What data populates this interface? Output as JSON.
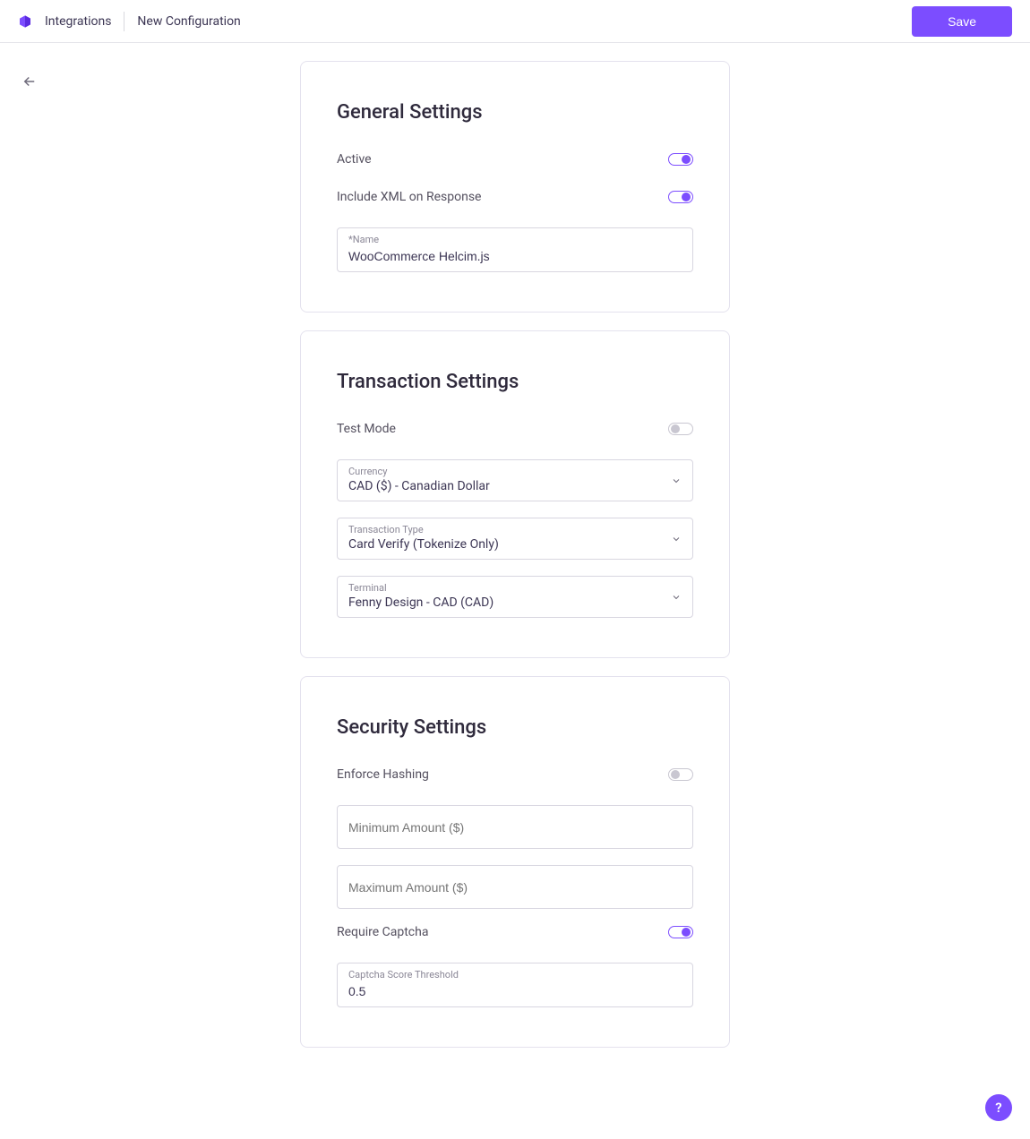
{
  "header": {
    "breadcrumb": [
      "Integrations",
      "New Configuration"
    ],
    "save_label": "Save"
  },
  "general": {
    "title": "General Settings",
    "active_label": "Active",
    "active_on": true,
    "include_xml_label": "Include XML on Response",
    "include_xml_on": true,
    "name_label": "*Name",
    "name_value": "WooCommerce Helcim.js"
  },
  "transaction": {
    "title": "Transaction Settings",
    "test_mode_label": "Test Mode",
    "test_mode_on": false,
    "currency_label": "Currency",
    "currency_value": "CAD ($) - Canadian Dollar",
    "txn_type_label": "Transaction Type",
    "txn_type_value": "Card Verify (Tokenize Only)",
    "terminal_label": "Terminal",
    "terminal_value": "Fenny Design - CAD (CAD)"
  },
  "security": {
    "title": "Security Settings",
    "enforce_hashing_label": "Enforce Hashing",
    "enforce_hashing_on": false,
    "min_amount_placeholder": "Minimum Amount ($)",
    "max_amount_placeholder": "Maximum Amount ($)",
    "require_captcha_label": "Require Captcha",
    "require_captcha_on": true,
    "captcha_threshold_label": "Captcha Score Threshold",
    "captcha_threshold_value": "0.5"
  },
  "help_label": "?"
}
